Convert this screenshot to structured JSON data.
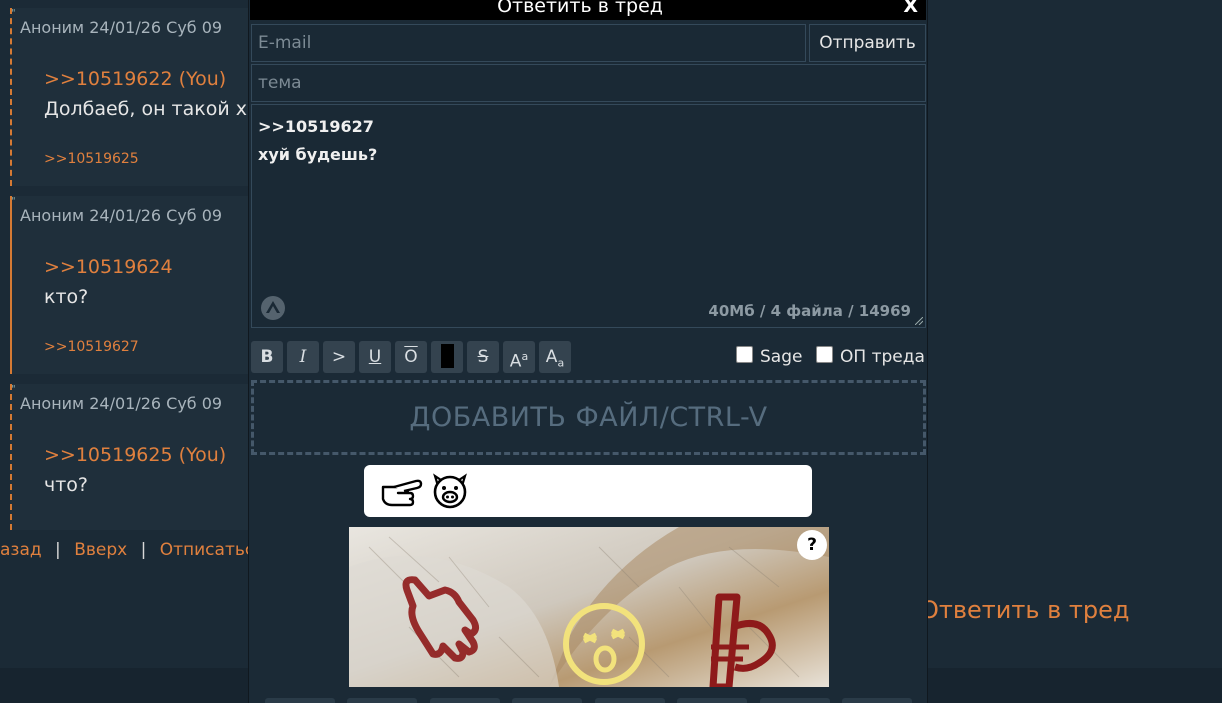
{
  "posts": [
    {
      "header": "Аноним 24/01/26 Суб 09",
      "reflink": ">>10519622 (You)",
      "text": "Долбаеб, он такой х",
      "reply": ">>10519625"
    },
    {
      "header": "Аноним 24/01/26 Суб 09",
      "reflink": ">>10519624",
      "text": "кто?",
      "reply": ">>10519627"
    },
    {
      "header": "Аноним 24/01/26 Суб 09",
      "reflink": ">>10519625 (You)",
      "text": "что?",
      "reply": ""
    }
  ],
  "nav": {
    "back": "азад",
    "sep": "|",
    "up": "Вверх",
    "unsubscribe": "Отписаться"
  },
  "reply_thread_link": "Ответить в тред",
  "form": {
    "title": "Ответить в тред",
    "close": "X",
    "email_placeholder": "E-mail",
    "send_label": "Отправить",
    "subject_placeholder": "тема",
    "message_lines": [
      ">>10519627",
      "хуй будешь?"
    ],
    "counter": "40Мб / 4 файла / 14969",
    "format_buttons": [
      "B",
      "I",
      ">",
      "U",
      "O",
      "",
      "S",
      "A",
      "A"
    ],
    "format_button_sup": [
      "",
      "",
      "",
      "",
      "",
      "",
      "",
      "a",
      "a"
    ],
    "sage_label": "Sage",
    "op_label": "ОП треда",
    "dropzone_label": "ДОБАВИТЬ ФАЙЛ/CTRL-V",
    "captcha_help": "?"
  },
  "icons": {
    "captcha_answer": [
      "pointing-hand-icon",
      "pig-face-icon"
    ],
    "captcha_image": [
      "pointing-down-hand-icon",
      "dizzy-face-icon",
      "flag-icon"
    ]
  },
  "colors": {
    "accent": "#e0803e",
    "background": "#1b2a36",
    "field_border": "#34495a"
  }
}
